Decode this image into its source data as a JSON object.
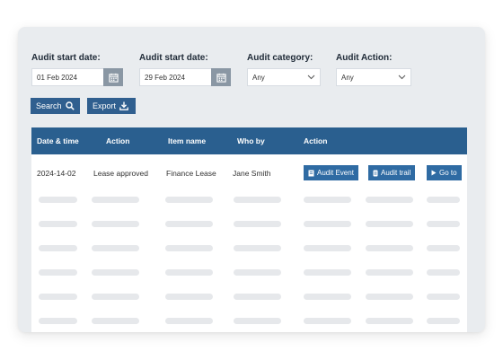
{
  "filters": {
    "start_date_1": {
      "label": "Audit start date:",
      "value": "01 Feb 2024"
    },
    "start_date_2": {
      "label": "Audit start date:",
      "value": "29 Feb 2024"
    },
    "category": {
      "label": "Audit category:",
      "value": "Any"
    },
    "action": {
      "label": "Audit Action:",
      "value": "Any"
    }
  },
  "toolbar": {
    "search_label": "Search",
    "export_label": "Export"
  },
  "table": {
    "headers": [
      "Date & time",
      "Action",
      "Item name",
      "Who by",
      "Action"
    ],
    "rows": [
      {
        "date": "2024-14-02",
        "action": "Lease approved",
        "item": "Finance Lease",
        "who": "Jane Smith",
        "buttons": [
          "Audit Event",
          "Audit trail",
          "Go to"
        ]
      }
    ]
  },
  "colors": {
    "accent": "#2a5f8f",
    "button": "#305f8f",
    "card_bg": "#e9ecef"
  },
  "icons": {
    "calendar": "calendar-icon",
    "search": "search-icon",
    "export": "download-icon",
    "chevron": "chevron-down-icon",
    "event": "document-icon",
    "trail": "list-icon",
    "goto": "play-icon"
  }
}
